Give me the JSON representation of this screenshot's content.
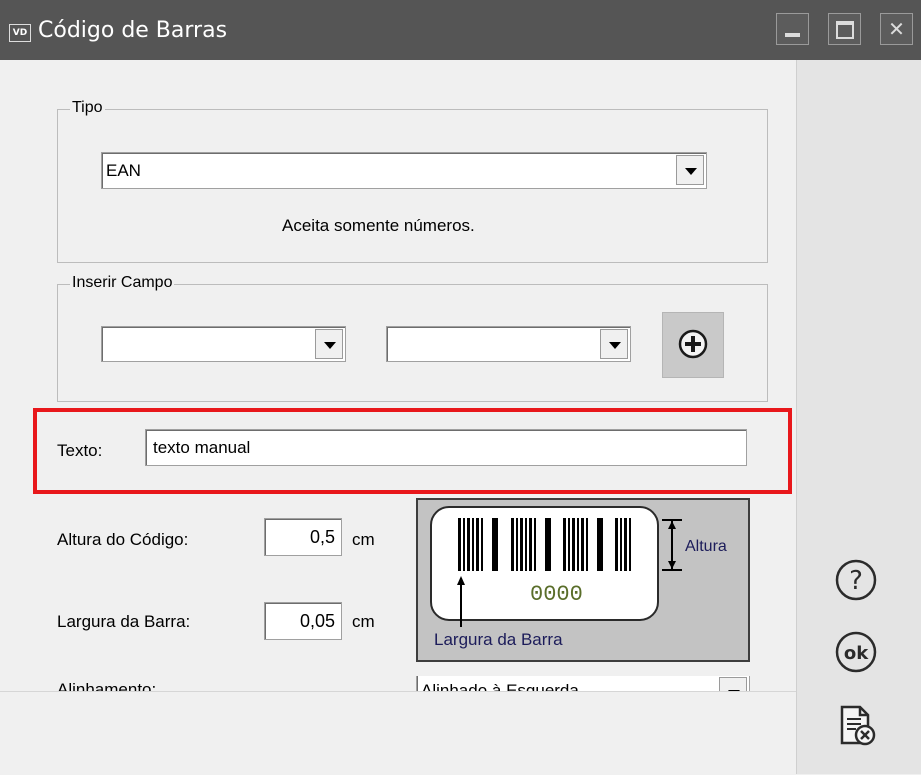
{
  "window": {
    "app_icon_text": "VD",
    "title": "Código de Barras",
    "controls": [
      "minimize",
      "maximize",
      "close"
    ]
  },
  "tipo": {
    "group_label": "Tipo",
    "selected": "EAN",
    "info": "Aceita somente números."
  },
  "inserir_campo": {
    "group_label": "Inserir Campo",
    "field1_value": "",
    "field2_value": "",
    "add_icon": "plus-circle-icon"
  },
  "texto": {
    "label": "Texto:",
    "value": "texto manual",
    "highlight_color": "#e8171b"
  },
  "altura": {
    "label": "Altura do Código:",
    "value": "0,5",
    "unit": "cm"
  },
  "largura": {
    "label": "Largura da Barra:",
    "value": "0,05",
    "unit": "cm"
  },
  "alinhamento": {
    "label": "Alinhamento:",
    "selected": "Alinhado à Esquerda"
  },
  "preview": {
    "digits": "0000",
    "altura_label": "Altura",
    "largura_label": "Largura da Barra"
  },
  "side_actions": [
    {
      "icon": "help-icon",
      "glyph": "?"
    },
    {
      "icon": "ok-icon",
      "glyph": "ok"
    },
    {
      "icon": "cancel-document-icon"
    }
  ]
}
